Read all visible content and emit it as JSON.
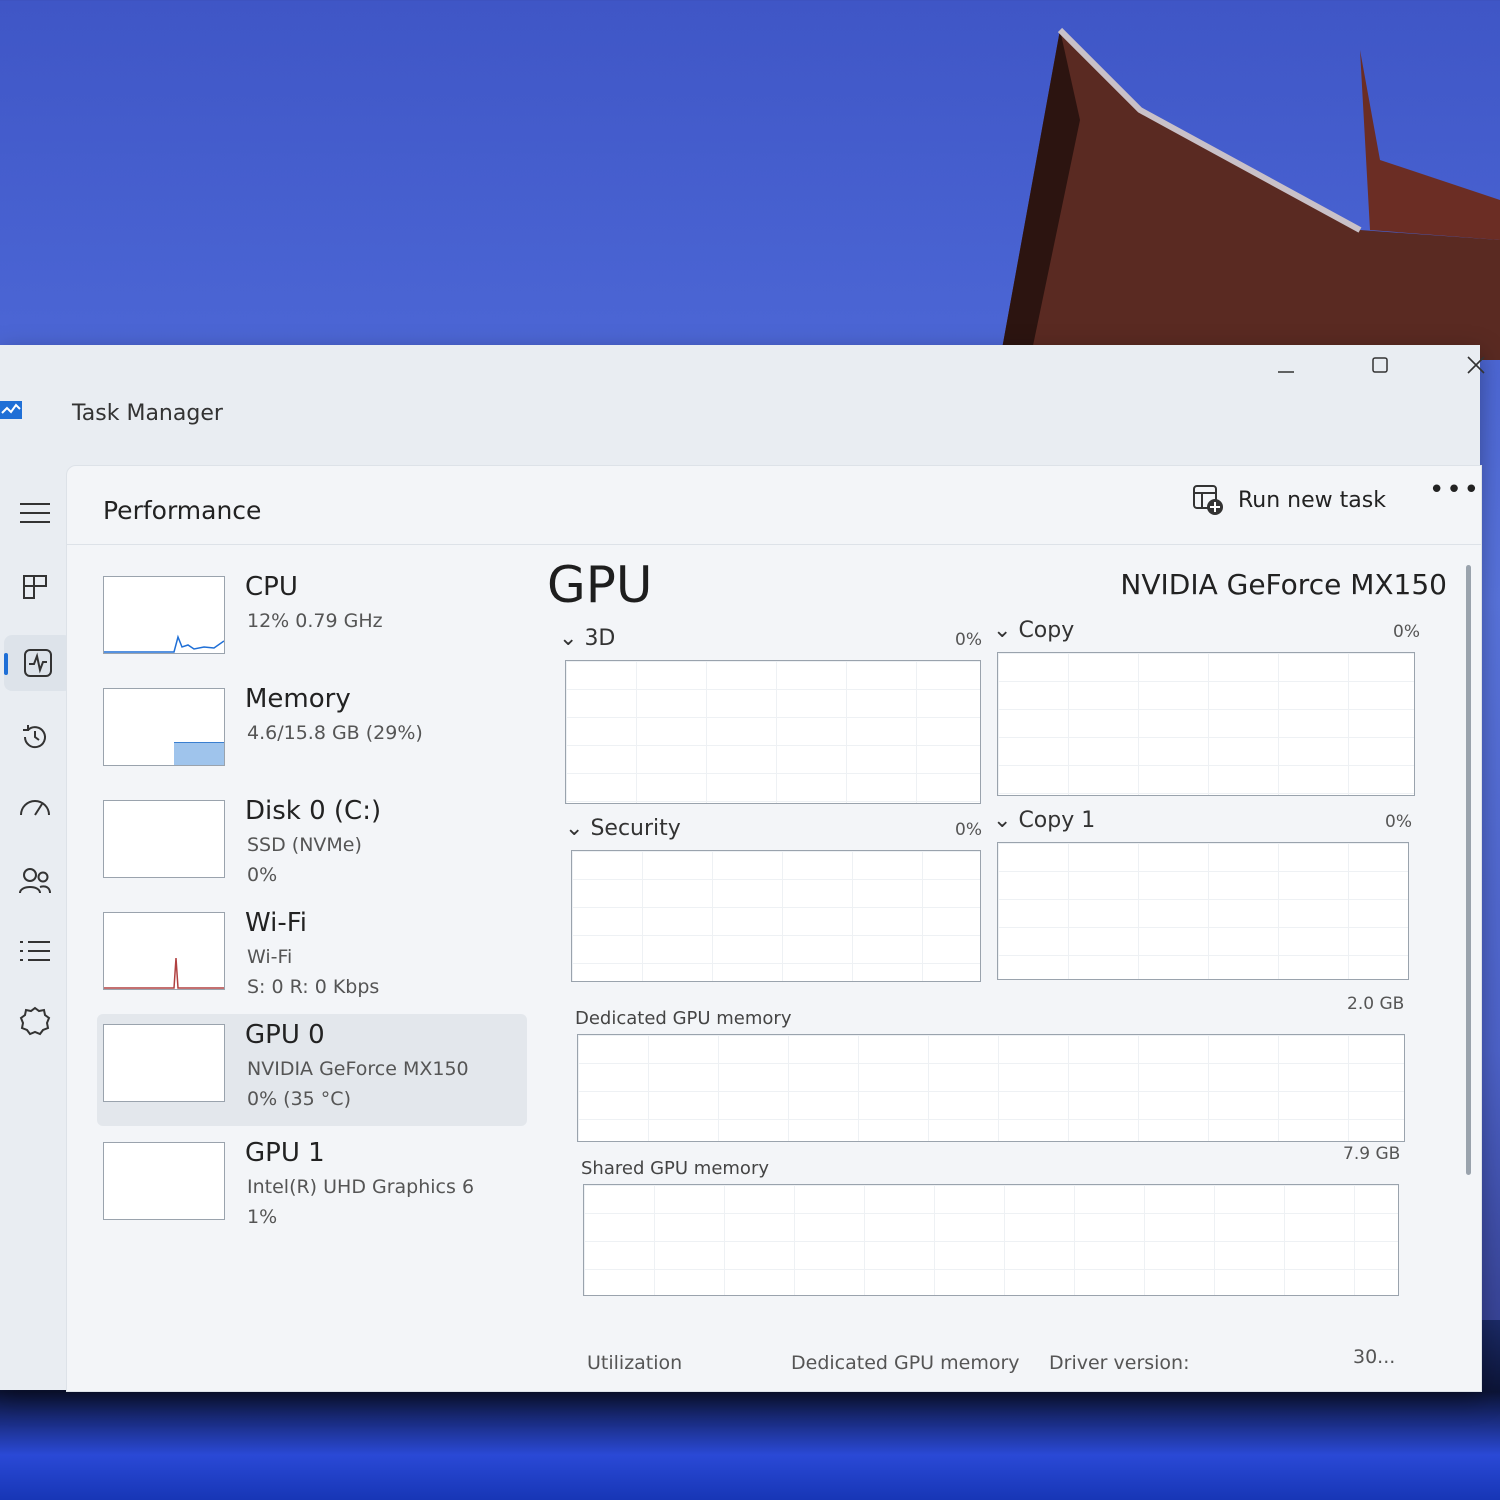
{
  "window": {
    "title": "Task Manager"
  },
  "header": {
    "title": "Performance",
    "run_new_task": "Run new task"
  },
  "nav": [
    {
      "name": "hamburger-menu-icon"
    },
    {
      "name": "processes-icon"
    },
    {
      "name": "performance-icon",
      "active": true
    },
    {
      "name": "app-history-icon"
    },
    {
      "name": "startup-apps-icon"
    },
    {
      "name": "users-icon"
    },
    {
      "name": "details-icon"
    },
    {
      "name": "services-icon"
    }
  ],
  "devices": {
    "cpu": {
      "name": "CPU",
      "sub": "12%  0.79 GHz"
    },
    "memory": {
      "name": "Memory",
      "sub": "4.6/15.8 GB (29%)",
      "fill_fraction": 0.29
    },
    "disk": {
      "name": "Disk 0 (C:)",
      "sub": "SSD (NVMe)",
      "sub2": "0%"
    },
    "wifi": {
      "name": "Wi-Fi",
      "sub": "Wi-Fi",
      "sub2": "S: 0  R: 0 Kbps"
    },
    "gpu0": {
      "name": "GPU 0",
      "sub": "NVIDIA GeForce MX150",
      "sub2": "0% (35 °C)"
    },
    "gpu1": {
      "name": "GPU 1",
      "sub": "Intel(R) UHD Graphics 6",
      "sub2": "1%"
    }
  },
  "gpu": {
    "title": "GPU",
    "model": "NVIDIA GeForce MX150",
    "engines": {
      "e3d": {
        "label": "3D",
        "pct": "0%"
      },
      "copy": {
        "label": "Copy",
        "pct": "0%"
      },
      "security": {
        "label": "Security",
        "pct": "0%"
      },
      "copy1": {
        "label": "Copy 1",
        "pct": "0%"
      }
    },
    "dedicated": {
      "label": "Dedicated GPU memory",
      "max": "2.0 GB"
    },
    "shared": {
      "label": "Shared GPU memory",
      "max": "7.9 GB"
    },
    "stats": {
      "utilization": "Utilization",
      "dedicated_mem": "Dedicated GPU memory",
      "driver_version": "Driver version:",
      "driver_value": "30..."
    }
  }
}
